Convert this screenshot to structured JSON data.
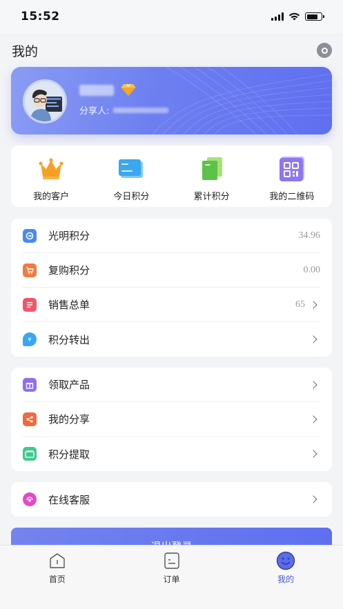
{
  "status_bar": {
    "time": "15:52"
  },
  "header": {
    "title": "我的"
  },
  "profile": {
    "sharer_label": "分享人:"
  },
  "quick_actions": [
    {
      "label": "我的客户",
      "icon": "crown-icon"
    },
    {
      "label": "今日积分",
      "icon": "card-icon"
    },
    {
      "label": "累计积分",
      "icon": "document-stack-icon"
    },
    {
      "label": "我的二维码",
      "icon": "qrcode-icon"
    }
  ],
  "points_menu": [
    {
      "label": "光明积分",
      "value": "34.96",
      "icon": "points-icon",
      "color": "#4a8af0"
    },
    {
      "label": "复购积分",
      "value": "0.00",
      "icon": "cart-icon",
      "color": "#f07b3f"
    },
    {
      "label": "销售总单",
      "value": "65",
      "icon": "sales-list-icon",
      "color": "#f0566a"
    },
    {
      "label": "积分转出",
      "value": "",
      "icon": "transfer-icon",
      "color": "#38a6f0"
    }
  ],
  "feature_menu": [
    {
      "label": "领取产品",
      "icon": "gift-icon",
      "color": "#8f6ff0"
    },
    {
      "label": "我的分享",
      "icon": "share-icon",
      "color": "#f06a3f"
    },
    {
      "label": "积分提取",
      "icon": "withdraw-icon",
      "color": "#3fc990"
    }
  ],
  "service_menu": [
    {
      "label": "在线客服",
      "icon": "customer-service-icon",
      "color": "#e648c8"
    }
  ],
  "logout": {
    "label": "退出登录"
  },
  "tabbar": [
    {
      "label": "首页",
      "icon": "home-icon",
      "active": false
    },
    {
      "label": "订单",
      "icon": "order-icon",
      "active": false
    },
    {
      "label": "我的",
      "icon": "smile-icon",
      "active": true
    }
  ],
  "colors": {
    "accent": "#5f6ff0",
    "active_tab": "#4457d6"
  }
}
